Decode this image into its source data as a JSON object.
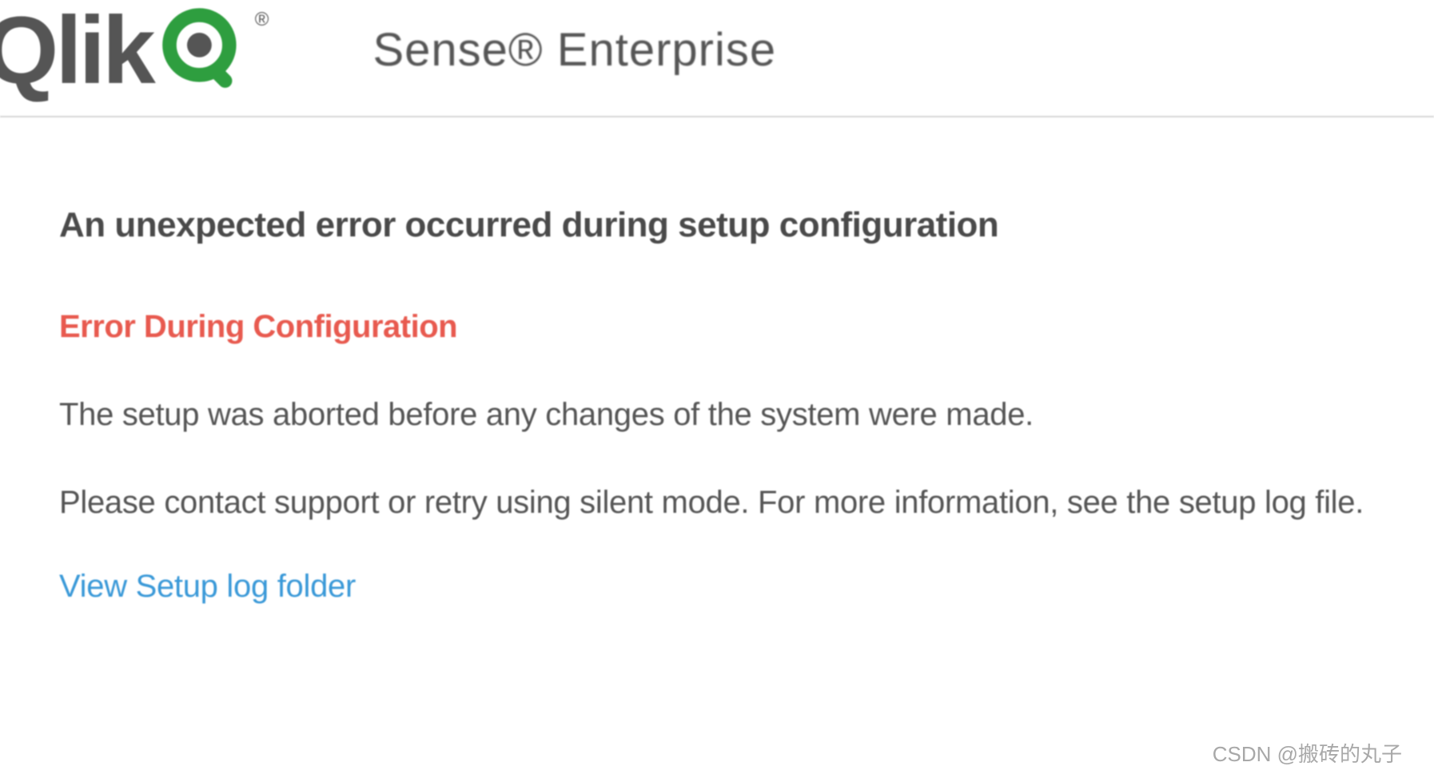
{
  "header": {
    "logo_text": "Qlik",
    "product_name": "Sense® Enterprise"
  },
  "content": {
    "main_heading": "An unexpected error occurred during setup configuration",
    "error_heading": "Error During Configuration",
    "body_text_1": "The setup was aborted before any changes of the system were made.",
    "body_text_2": "Please contact support or retry using silent mode. For more information, see the setup log file.",
    "link_label": "View Setup log folder"
  },
  "watermark": "CSDN @搬砖的丸子"
}
